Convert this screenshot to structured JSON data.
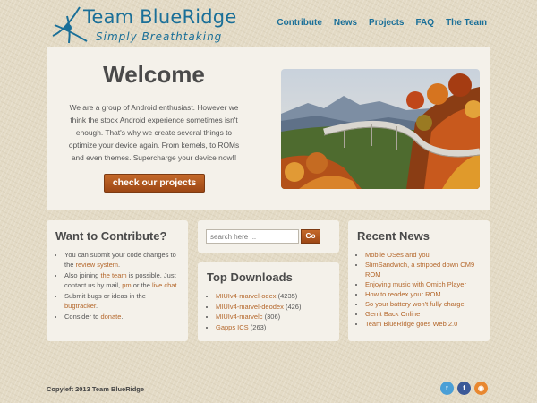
{
  "brand": {
    "title": "Team BlueRidge",
    "tagline": "Simply Breathtaking"
  },
  "nav": {
    "items": [
      {
        "label": "Contribute"
      },
      {
        "label": "News"
      },
      {
        "label": "Projects"
      },
      {
        "label": "FAQ"
      },
      {
        "label": "The Team"
      }
    ]
  },
  "hero": {
    "heading": "Welcome",
    "body": "We are a group of Android enthusiast. However we think the stock Android experience sometimes isn't enough. That's why we create several things to optimize your device again. From kernels, to ROMs and even themes. Supercharge your device now!!",
    "cta_label": "check our projects",
    "image_icon": "landscape-photo-icon"
  },
  "contribute": {
    "heading": "Want to Contribute?",
    "items": [
      {
        "pre": "You can submit your code changes to the ",
        "links": [
          {
            "text": "review system"
          }
        ],
        "post": "."
      },
      {
        "pre": "Also joining ",
        "link1": "the team",
        "mid": " is possible. Just contact us by mail, ",
        "link2": "pm",
        "mid2": " or the ",
        "link3": "live chat",
        "post": "."
      },
      {
        "pre": "Submit bugs or ideas in the ",
        "link1": "bugtracker",
        "post": "."
      },
      {
        "pre": "Consider to ",
        "link1": "donate",
        "post": "."
      }
    ]
  },
  "search": {
    "placeholder": "search here ...",
    "button_label": "Go"
  },
  "downloads": {
    "heading": "Top Downloads",
    "items": [
      {
        "name": "MIUIv4-marvel-odex",
        "count": "(4235)"
      },
      {
        "name": "MIUIv4-marvel-deodex",
        "count": "(426)"
      },
      {
        "name": "MIUIv4-marvelc",
        "count": "(306)"
      },
      {
        "name": "Gapps ICS",
        "count": "(263)"
      }
    ]
  },
  "news": {
    "heading": "Recent News",
    "items": [
      "Mobile OSes and you",
      "SlimSandwich, a stripped down CM9 ROM",
      "Enjoying music with Omich Player",
      "How to reodex your ROM",
      "So your battery won't fully charge",
      "Gerrit Back Online",
      "Team BlueRidge goes Web 2.0"
    ]
  },
  "footer": {
    "copyright": "Copyleft 2013 Team BlueRidge",
    "social": [
      {
        "icon": "twitter-icon",
        "glyph": "t",
        "color": "#4a9fd6"
      },
      {
        "icon": "facebook-icon",
        "glyph": "f",
        "color": "#3b5998"
      },
      {
        "icon": "rss-icon",
        "glyph": "◉",
        "color": "#e8872f"
      }
    ]
  },
  "colors": {
    "accent_blue": "#1a6f98",
    "accent_orange": "#b4672b",
    "button_orange": "#b35a1f",
    "panel": "#f4f1ea"
  }
}
